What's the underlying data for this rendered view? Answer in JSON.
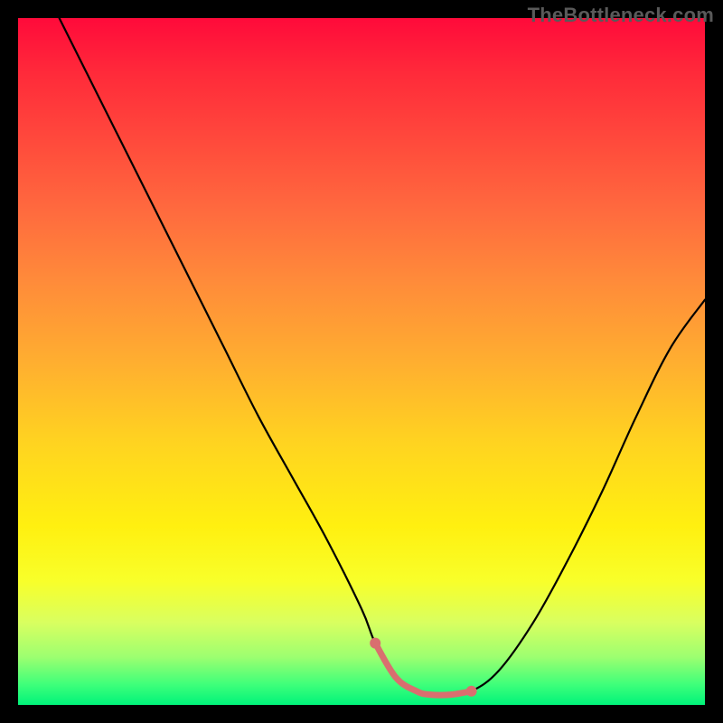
{
  "watermark": "TheBottleneck.com",
  "colors": {
    "frame": "#000000",
    "curve": "#000000",
    "highlight": "#d96f6f",
    "gradient_top": "#ff0a3a",
    "gradient_bottom": "#00f37a"
  },
  "chart_data": {
    "type": "line",
    "title": "",
    "xlabel": "",
    "ylabel": "",
    "xlim": [
      0,
      100
    ],
    "ylim": [
      0,
      100
    ],
    "grid": false,
    "annotations": [
      "TheBottleneck.com"
    ],
    "series": [
      {
        "name": "bottleneck-curve",
        "x": [
          6,
          10,
          15,
          20,
          25,
          30,
          35,
          40,
          45,
          50,
          52,
          55,
          58,
          60,
          63,
          66,
          70,
          75,
          80,
          85,
          90,
          95,
          100
        ],
        "y": [
          100,
          92,
          82,
          72,
          62,
          52,
          42,
          33,
          24,
          14,
          9,
          4,
          2,
          1.5,
          1.5,
          2,
          5,
          12,
          21,
          31,
          42,
          52,
          59
        ]
      }
    ],
    "highlight": {
      "name": "optimal-range",
      "x": [
        52,
        55,
        58,
        60,
        63,
        66
      ],
      "y": [
        9,
        4,
        2,
        1.5,
        1.5,
        2
      ]
    }
  }
}
